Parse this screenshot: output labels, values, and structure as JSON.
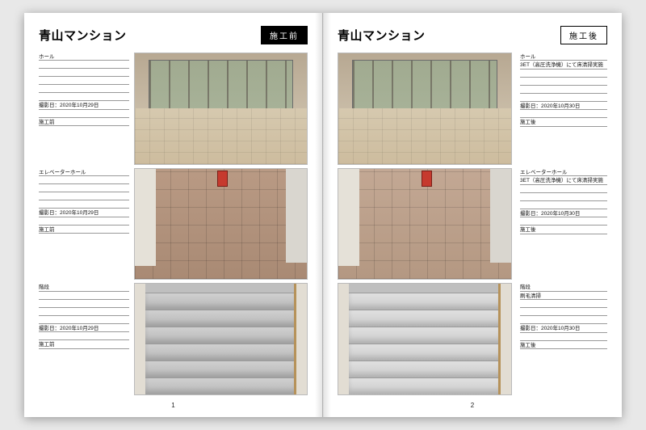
{
  "book": {
    "left": {
      "title": "青山マンション",
      "badge": "施工前",
      "page_number": "1",
      "rows": [
        {
          "lines": [
            "ホール",
            "",
            "",
            "",
            "",
            "",
            "撮影日：2020年10月29日",
            "",
            "施工前"
          ],
          "photo_kind": "hall"
        },
        {
          "lines": [
            "エレベーターホール",
            "",
            "",
            "",
            "",
            "撮影日：2020年10月29日",
            "",
            "施工前"
          ],
          "photo_kind": "tiles"
        },
        {
          "lines": [
            "階段",
            "",
            "",
            "",
            "",
            "撮影日：2020年10月29日",
            "",
            "施工前"
          ],
          "photo_kind": "stairs"
        }
      ]
    },
    "right": {
      "title": "青山マンション",
      "badge": "施工後",
      "page_number": "2",
      "rows": [
        {
          "lines": [
            "ホール",
            "3ET（高圧洗浄機）にて床清掃実施",
            "",
            "",
            "",
            "",
            "撮影日：2020年10月30日",
            "",
            "施工後"
          ],
          "photo_kind": "hall"
        },
        {
          "lines": [
            "エレベーターホール",
            "3ET（高圧洗浄機）にて床清掃実施",
            "",
            "",
            "",
            "撮影日：2020年10月30日",
            "",
            "施工後"
          ],
          "photo_kind": "tiles-after"
        },
        {
          "lines": [
            "階段",
            "刷毛清掃",
            "",
            "",
            "",
            "撮影日：2020年10月30日",
            "",
            "施工後"
          ],
          "photo_kind": "stairs-after"
        }
      ]
    }
  }
}
